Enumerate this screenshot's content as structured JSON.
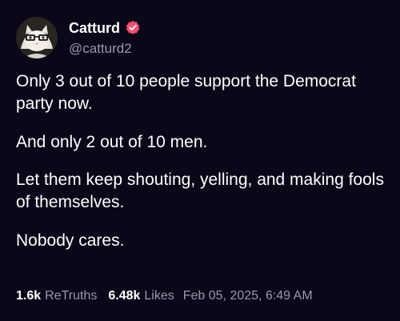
{
  "post": {
    "author": {
      "display_name": "Catturd",
      "handle": "@catturd2",
      "verified_icon": "verified-check-icon",
      "verified_color": "#ff4d6d"
    },
    "paragraphs": [
      "Only 3 out of 10 people support the Democrat party now.",
      "And only 2 out of 10 men.",
      "Let them keep shouting, yelling, and making fools of themselves.",
      "Nobody cares."
    ],
    "stats": {
      "retruths_count": "1.6k",
      "retruths_label": "ReTruths",
      "likes_count": "6.48k",
      "likes_label": "Likes",
      "timestamp": "Feb 05, 2025, 6:49 AM"
    }
  },
  "colors": {
    "background": "#0a0818",
    "text_primary": "#ffffff",
    "text_secondary": "#9a98a8"
  }
}
